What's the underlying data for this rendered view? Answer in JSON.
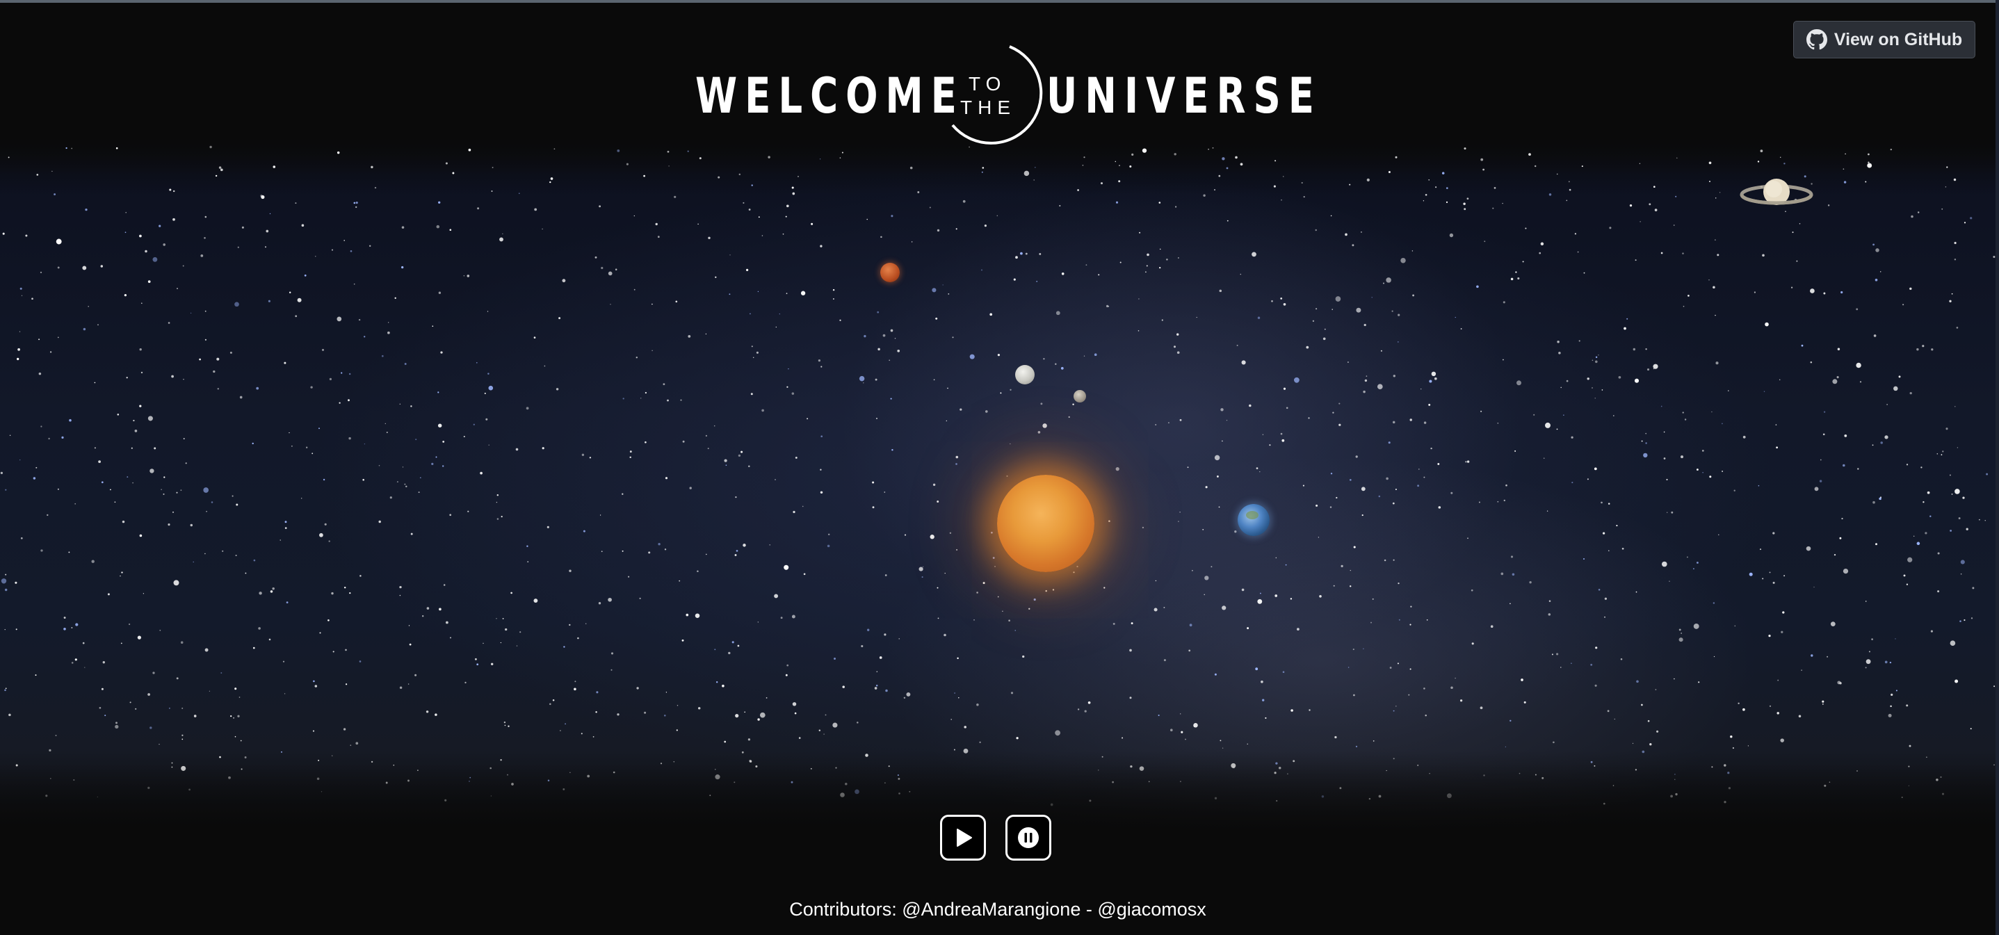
{
  "header": {
    "title_left": "WELCOME",
    "title_small_top": "TO",
    "title_small_bottom": "THE",
    "title_right": "UNIVERSE"
  },
  "github_button": {
    "label": "View on GitHub",
    "icon": "github-icon"
  },
  "scene": {
    "bodies": [
      "sun",
      "mars",
      "moon",
      "small-moon",
      "earth",
      "saturn"
    ]
  },
  "controls": {
    "play_icon": "play-icon",
    "pause_icon": "pause-icon"
  },
  "footer": {
    "contributors": "Contributors: @AndreaMarangione - @giacomosx"
  },
  "colors": {
    "background": "#0a0a0a",
    "button_bg": "#2b2f36",
    "text": "#ffffff"
  }
}
